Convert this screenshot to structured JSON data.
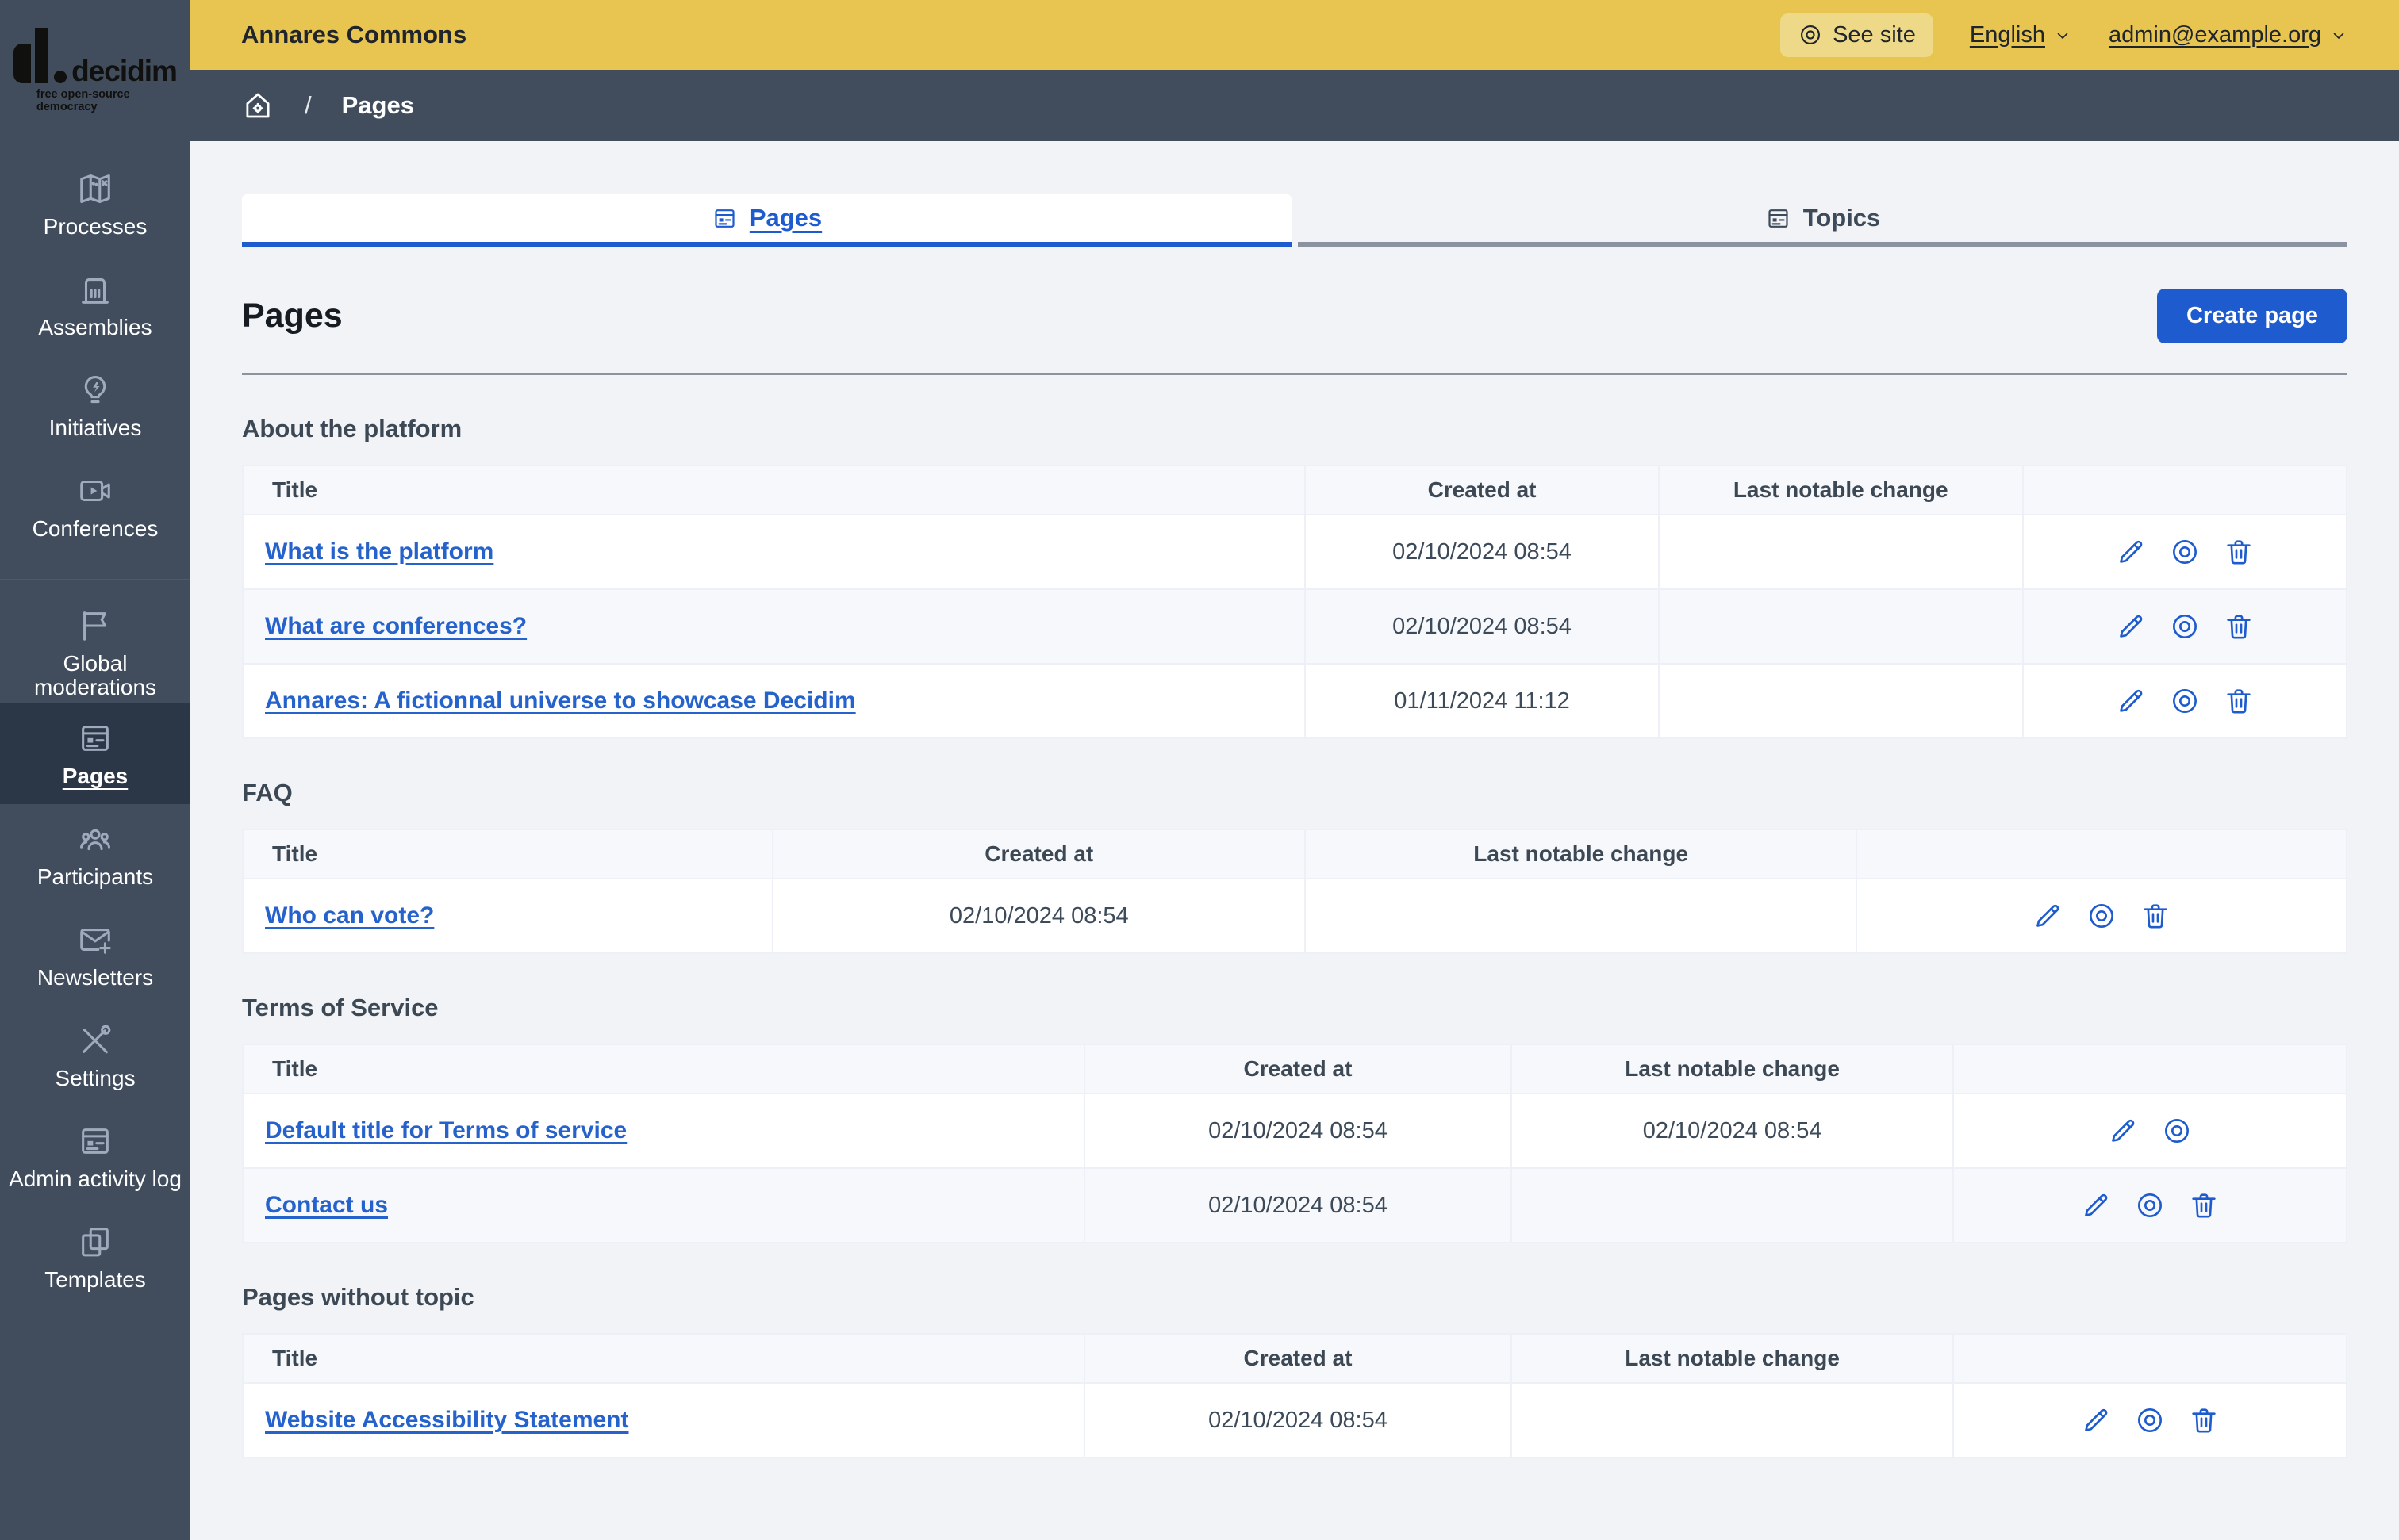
{
  "brand": {
    "name": "decidim",
    "tagline": "free open-source democracy"
  },
  "topbar": {
    "org_name": "Annares Commons",
    "see_site_label": "See site",
    "language_label": "English",
    "account_label": "admin@example.org"
  },
  "breadcrumb": {
    "separator": "/",
    "current": "Pages"
  },
  "sidebar": {
    "items": [
      {
        "label": "Processes",
        "icon": "map-icon",
        "active": false,
        "group": 1
      },
      {
        "label": "Assemblies",
        "icon": "building-icon",
        "active": false,
        "group": 1
      },
      {
        "label": "Initiatives",
        "icon": "lightbulb-icon",
        "active": false,
        "group": 1
      },
      {
        "label": "Conferences",
        "icon": "video-icon",
        "active": false,
        "group": 1
      },
      {
        "label": "Global moderations",
        "icon": "flag-icon",
        "active": false,
        "group": 2
      },
      {
        "label": "Pages",
        "icon": "article-icon",
        "active": true,
        "group": 2
      },
      {
        "label": "Participants",
        "icon": "people-icon",
        "active": false,
        "group": 2
      },
      {
        "label": "Newsletters",
        "icon": "mail-add-icon",
        "active": false,
        "group": 2
      },
      {
        "label": "Settings",
        "icon": "tools-icon",
        "active": false,
        "group": 2
      },
      {
        "label": "Admin activity log",
        "icon": "article-icon",
        "active": false,
        "group": 2
      },
      {
        "label": "Templates",
        "icon": "copy-icon",
        "active": false,
        "group": 2
      }
    ]
  },
  "tabs": [
    {
      "label": "Pages",
      "icon": "article-icon",
      "active": true
    },
    {
      "label": "Topics",
      "icon": "article-icon",
      "active": false
    }
  ],
  "page": {
    "title": "Pages",
    "create_button_label": "Create page"
  },
  "table_columns": {
    "title": "Title",
    "created_at": "Created at",
    "last_change": "Last notable change"
  },
  "sections": [
    {
      "heading": "About the platform",
      "rows": [
        {
          "title": "What is the platform",
          "created_at": "02/10/2024 08:54",
          "last_change": "",
          "actions": [
            "edit",
            "preview",
            "delete"
          ]
        },
        {
          "title": "What are conferences?",
          "created_at": "02/10/2024 08:54",
          "last_change": "",
          "actions": [
            "edit",
            "preview",
            "delete"
          ]
        },
        {
          "title": "Annares: A fictionnal universe to showcase Decidim",
          "created_at": "01/11/2024 11:12",
          "last_change": "",
          "actions": [
            "edit",
            "preview",
            "delete"
          ]
        }
      ]
    },
    {
      "heading": "FAQ",
      "rows": [
        {
          "title": "Who can vote?",
          "created_at": "02/10/2024 08:54",
          "last_change": "",
          "actions": [
            "edit",
            "preview",
            "delete"
          ]
        }
      ]
    },
    {
      "heading": "Terms of Service",
      "rows": [
        {
          "title": "Default title for Terms of service",
          "created_at": "02/10/2024 08:54",
          "last_change": "02/10/2024 08:54",
          "actions": [
            "edit",
            "preview"
          ]
        },
        {
          "title": "Contact us",
          "created_at": "02/10/2024 08:54",
          "last_change": "",
          "actions": [
            "edit",
            "preview",
            "delete"
          ]
        }
      ]
    },
    {
      "heading": "Pages without topic",
      "rows": [
        {
          "title": "Website Accessibility Statement",
          "created_at": "02/10/2024 08:54",
          "last_change": "",
          "actions": [
            "edit",
            "preview",
            "delete"
          ]
        }
      ]
    }
  ],
  "colors": {
    "accent_blue": "#1d5bce",
    "topbar_yellow": "#e8c551",
    "sidebar": "#414d5d",
    "sidebar_active": "#2b3646",
    "page_background": "#f1f3f6"
  }
}
